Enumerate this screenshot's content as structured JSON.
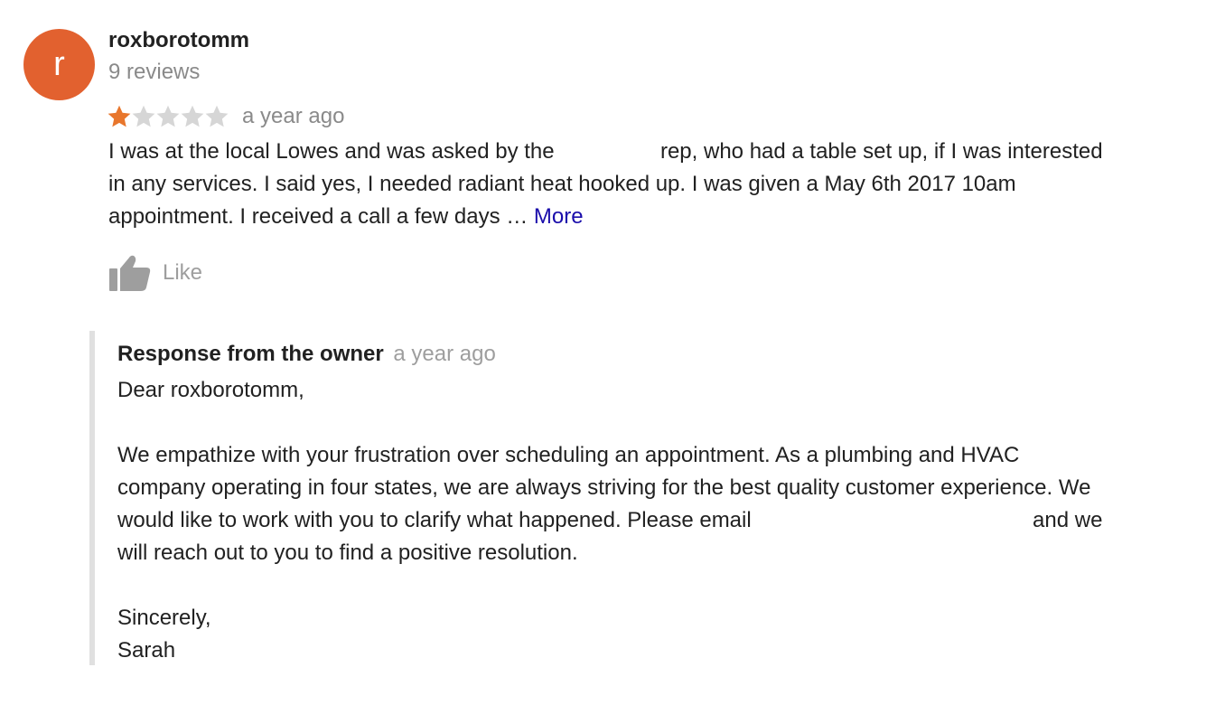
{
  "review": {
    "avatar_letter": "r",
    "author": "roxborotomm",
    "review_count": "9 reviews",
    "rating": 1,
    "max_rating": 5,
    "time": "a year ago",
    "text_line1_a": "I was at the local Lowes and was asked by the",
    "text_line1_b": "rep, who had a table set up, if I was interested",
    "text_line2": "in any services. I said yes, I needed radiant heat hooked up. I was given a May 6th 2017 10am",
    "text_line3": "appointment. I received a call a few days …",
    "more_label": "More",
    "like_label": "Like"
  },
  "response": {
    "title": "Response from the owner",
    "time": "a year ago",
    "greeting": "Dear roxborotomm,",
    "p1_line1": "We empathize with your frustration over scheduling an appointment. As a plumbing and HVAC",
    "p1_line2": "company operating in four states, we are always striving for the best quality customer experience. We",
    "p1_line3_a": "would like to work with you to clarify what happened. Please email",
    "p1_line3_b": "and we",
    "p1_line4": "will reach out to you to find a positive resolution.",
    "closing": "Sincerely,",
    "signature": "Sarah"
  },
  "colors": {
    "avatar": "#e2612f",
    "star_filled": "#e8762c",
    "star_empty": "#d6d6d6",
    "link": "#1a0dab",
    "muted": "#8a8a8a",
    "border": "#e0e0e0"
  },
  "icons": {
    "like": "thumbs-up-icon",
    "star": "star-icon"
  }
}
